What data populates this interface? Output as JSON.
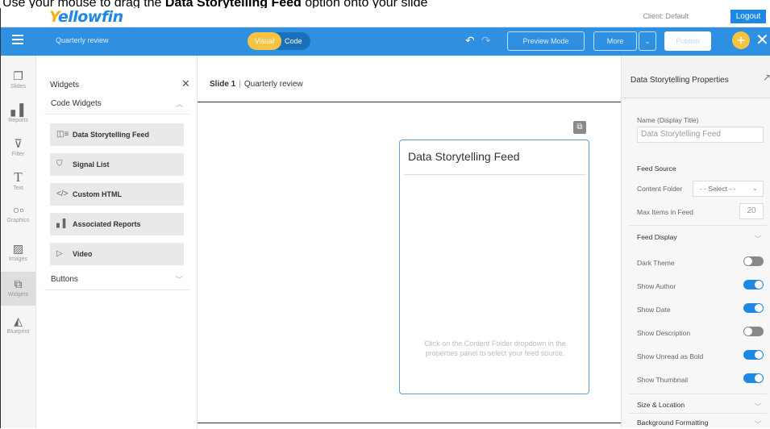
{
  "instruction": {
    "prefix": "Use your mouse to drag the ",
    "bold": "Data Storytelling Feed",
    "suffix": " option onto your slide"
  },
  "topbar": {
    "logo_y": "Y",
    "logo_rest": "ellowfin",
    "client": "Client: Default",
    "logout": "Logout"
  },
  "toolbar": {
    "document_title": "Quarterly review",
    "mode_visual": "Visual",
    "mode_code": "Code",
    "preview_mode": "Preview Mode",
    "more": "More",
    "publish": "Publish"
  },
  "leftnav": [
    {
      "label": "Slides"
    },
    {
      "label": "Reports"
    },
    {
      "label": "Filter"
    },
    {
      "label": "Text"
    },
    {
      "label": "Graphics"
    },
    {
      "label": "Images"
    },
    {
      "label": "Widgets"
    },
    {
      "label": "Blueprint"
    }
  ],
  "widgets_panel": {
    "title": "Widgets",
    "code_widgets": "Code Widgets",
    "items": [
      {
        "label": "Data Storytelling Feed"
      },
      {
        "label": "Signal List"
      },
      {
        "label": "Custom HTML"
      },
      {
        "label": "Associated Reports"
      },
      {
        "label": "Video"
      }
    ],
    "buttons": "Buttons"
  },
  "canvas": {
    "slide": "Slide 1",
    "separator": "|",
    "slide_name": "Quarterly review",
    "feed_title": "Data Storytelling Feed",
    "feed_hint": "Click on the Content Folder dropdown in the properties panel to select your feed source."
  },
  "properties": {
    "title": "Data Storytelling Properties",
    "name_label": "Name (Display Title)",
    "name_value": "Data Storytelling Feed",
    "feed_source": "Feed Source",
    "content_folder": "Content Folder",
    "content_folder_value": "- - Select - -",
    "max_items": "Max Items in Feed",
    "max_items_value": "20",
    "feed_display": "Feed Display",
    "toggles": [
      {
        "label": "Dark Theme",
        "on": false
      },
      {
        "label": "Show Author",
        "on": true
      },
      {
        "label": "Show Date",
        "on": true
      },
      {
        "label": "Show Description",
        "on": false
      },
      {
        "label": "Show Unread as Bold",
        "on": true
      },
      {
        "label": "Show Thumbnail",
        "on": true
      }
    ],
    "size_location": "Size & Location",
    "background_formatting": "Background Formatting"
  }
}
